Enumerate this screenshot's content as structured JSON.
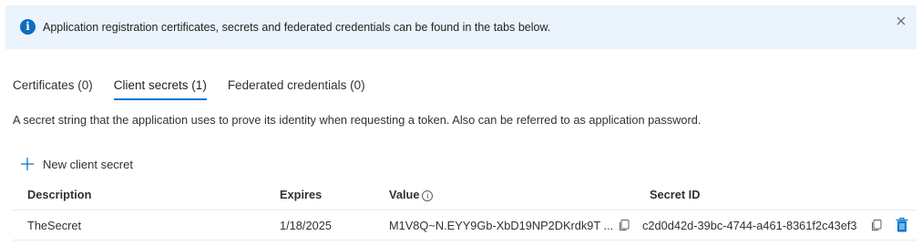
{
  "banner": {
    "message": "Application registration certificates, secrets and federated credentials can be found in the tabs below."
  },
  "tabs": [
    {
      "label": "Certificates (0)"
    },
    {
      "label": "Client secrets (1)"
    },
    {
      "label": "Federated credentials (0)"
    }
  ],
  "description": "A secret string that the application uses to prove its identity when requesting a token. Also can be referred to as application password.",
  "toolbar": {
    "new_secret_label": "New client secret"
  },
  "table": {
    "headers": {
      "description": "Description",
      "expires": "Expires",
      "value": "Value",
      "secret_id": "Secret ID"
    },
    "rows": [
      {
        "description": "TheSecret",
        "expires": "1/18/2025",
        "value": "M1V8Q~N.EYY9Gb-XbD19NP2DKrdk9T ...",
        "secret_id": "c2d0d42d-39bc-4744-a461-8361f2c43ef3"
      }
    ]
  },
  "colors": {
    "accent": "#0078d4",
    "banner_bg": "#ebf3fc",
    "info_icon": "#0f6cbd",
    "delete": "#0078d4"
  }
}
